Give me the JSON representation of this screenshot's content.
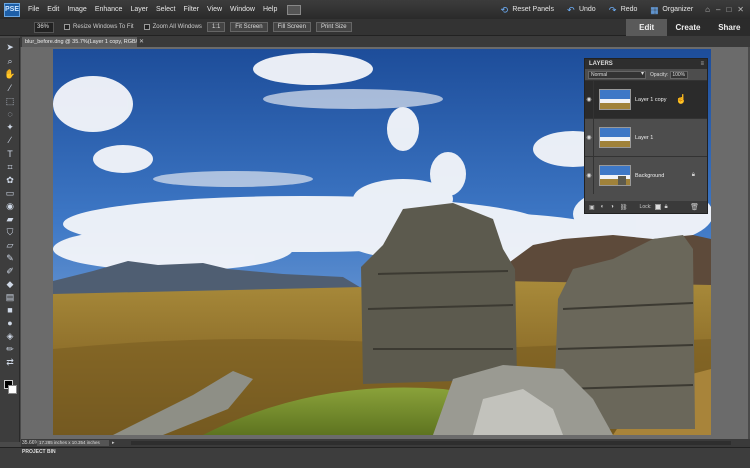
{
  "app": {
    "logo": "PSE"
  },
  "menubar": {
    "items": [
      "File",
      "Edit",
      "Image",
      "Enhance",
      "Layer",
      "Select",
      "Filter",
      "View",
      "Window",
      "Help"
    ],
    "actions": {
      "reset_panels": "Reset Panels",
      "undo": "Undo",
      "redo": "Redo",
      "organizer": "Organizer"
    }
  },
  "options": {
    "zoom": "36%",
    "resize_windows": "Resize Windows To Fit",
    "zoom_all_windows": "Zoom All Windows",
    "btn_1to1": "1:1",
    "btn_fit_screen": "Fit Screen",
    "btn_fill_screen": "Fill Screen",
    "btn_print_size": "Print Size"
  },
  "mode_tabs": [
    "Edit",
    "Create",
    "Share"
  ],
  "document": {
    "tab_title": "blur_before.dng @ 35.7%(Layer 1 copy, RGB/8) *"
  },
  "layers_panel": {
    "title": "LAYERS",
    "blend_mode": "Normal",
    "opacity_label": "Opacity:",
    "opacity_value": "100%",
    "layers": [
      {
        "name": "Layer 1 copy",
        "active": true
      },
      {
        "name": "Layer 1",
        "active": false
      },
      {
        "name": "Background",
        "active": false
      }
    ],
    "lock_label": "Lock:"
  },
  "status": {
    "zoom": "35.66%",
    "info": "17.285 inches x 10.354 inches"
  },
  "project_bin": {
    "label": "PROJECT BIN"
  },
  "colors": {
    "accent": "#6fb3ff",
    "panel_bg": "#4d4d4d",
    "chrome_bg": "#3a3a3a"
  }
}
